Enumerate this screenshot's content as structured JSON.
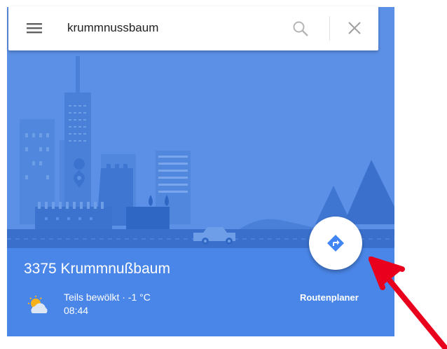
{
  "search": {
    "value": "krummnussbaum"
  },
  "place": {
    "name": "3375 Krummnußbaum",
    "weather": {
      "condition": "Teils bewölkt · -1 °C",
      "time": "08:44"
    }
  },
  "route": {
    "label": "Routenplaner"
  },
  "icons": {
    "menu": "hamburger-menu-icon",
    "search": "magnifier-icon",
    "close": "close-x-icon",
    "route": "directions-diamond-icon",
    "weather": "partly-cloudy-icon"
  },
  "colors": {
    "sky": "#5b90e6",
    "info_bar": "#4a86e8",
    "route_icon": "#4285f4",
    "pointer_arrow": "#e8001c"
  }
}
